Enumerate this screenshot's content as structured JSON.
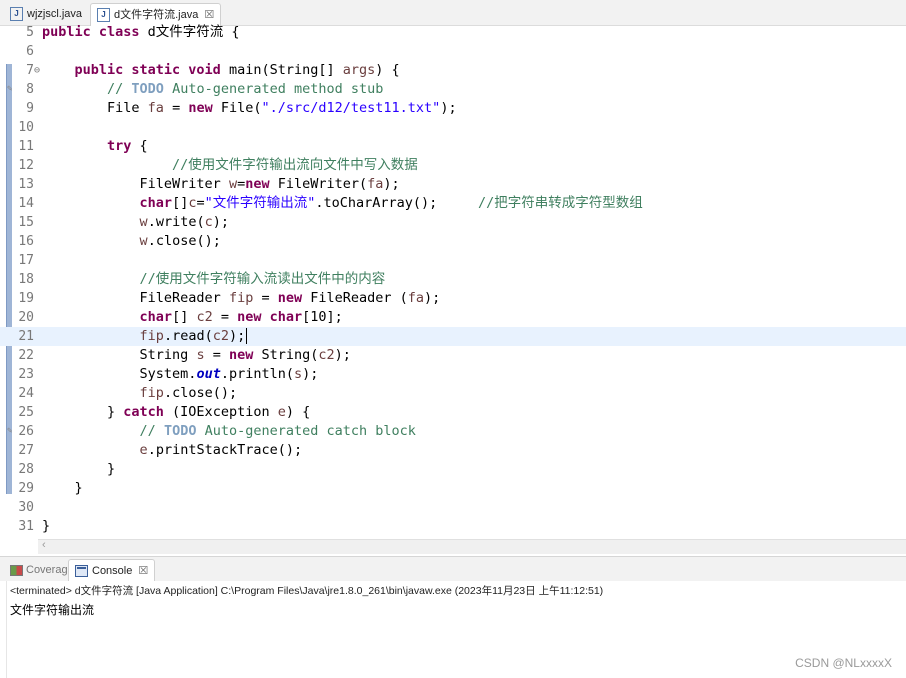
{
  "editor_tabs": [
    {
      "label": "wjzjscl.java",
      "icon": "java-file-icon",
      "active": false
    },
    {
      "label": "d文件字符流.java",
      "icon": "java-file-icon",
      "active": true,
      "close": "☒"
    }
  ],
  "code_lines": [
    {
      "num": "5",
      "html": "<span class=\"kw\">public class</span> d文件字符流 {",
      "clip": true
    },
    {
      "num": "6",
      "html": ""
    },
    {
      "num": "7",
      "fold": "⊖",
      "html": "    <span class=\"kw\">public static void</span> main(String[] <span class=\"var\">args</span>) {"
    },
    {
      "num": "8",
      "mark": "✎",
      "html": "        <span class=\"cm\">// </span><span class=\"todo\">TODO</span><span class=\"cm\"> Auto-generated method stub</span>"
    },
    {
      "num": "9",
      "html": "        File <span class=\"var\">fa</span> = <span class=\"kw\">new</span> File(<span class=\"str\">\"./src/d12/test11.txt\"</span>);"
    },
    {
      "num": "10",
      "html": ""
    },
    {
      "num": "11",
      "html": "        <span class=\"kw\">try</span> {"
    },
    {
      "num": "12",
      "html": "                <span class=\"cm\">//使用文件字符输出流向文件中写入数据</span>"
    },
    {
      "num": "13",
      "html": "            FileWriter <span class=\"var\">w</span>=<span class=\"kw\">new</span> FileWriter(<span class=\"var\">fa</span>);"
    },
    {
      "num": "14",
      "html": "            <span class=\"kw\">char</span>[]<span class=\"var\">c</span>=<span class=\"str\">\"文件字符输出流\"</span>.toCharArray();     <span class=\"cm\">//把字符串转成字符型数组</span>"
    },
    {
      "num": "15",
      "html": "            <span class=\"var\">w</span>.write(<span class=\"var\">c</span>);"
    },
    {
      "num": "16",
      "html": "            <span class=\"var\">w</span>.close();"
    },
    {
      "num": "17",
      "html": ""
    },
    {
      "num": "18",
      "html": "            <span class=\"cm\">//使用文件字符输入流读出文件中的内容</span>"
    },
    {
      "num": "19",
      "html": "            FileReader <span class=\"var\">fip</span> = <span class=\"kw\">new</span> FileReader (<span class=\"var\">fa</span>);"
    },
    {
      "num": "20",
      "html": "            <span class=\"kw\">char</span>[] <span class=\"var\">c2</span> = <span class=\"kw\">new char</span>[10];"
    },
    {
      "num": "21",
      "current": true,
      "html": "            <span class=\"var\">fip</span>.read(<span class=\"var\">c2</span>);<span class=\"caret\"></span>"
    },
    {
      "num": "22",
      "html": "            String <span class=\"var\">s</span> = <span class=\"kw\">new</span> String(<span class=\"var\">c2</span>);"
    },
    {
      "num": "23",
      "html": "            System.<span class=\"field\">out</span>.println(<span class=\"var\">s</span>);"
    },
    {
      "num": "24",
      "html": "            <span class=\"var\">fip</span>.close();"
    },
    {
      "num": "25",
      "html": "        } <span class=\"kw\">catch</span> (IOException <span class=\"var\">e</span>) {"
    },
    {
      "num": "26",
      "mark": "✎",
      "html": "            <span class=\"cm\">// </span><span class=\"todo\">TODO</span><span class=\"cm\"> Auto-generated catch block</span>"
    },
    {
      "num": "27",
      "html": "            <span class=\"var\">e</span>.printStackTrace();"
    },
    {
      "num": "28",
      "html": "        }"
    },
    {
      "num": "29",
      "html": "    }"
    },
    {
      "num": "30",
      "html": ""
    },
    {
      "num": "31",
      "html": "}"
    }
  ],
  "hscroll_arrow": "‹",
  "panel_tabs": [
    {
      "label": "Coverage",
      "active": false
    },
    {
      "label": "Console",
      "active": true,
      "close": "☒"
    }
  ],
  "console": {
    "terminated": "<terminated> d文件字符流 [Java Application] C:\\Program Files\\Java\\jre1.8.0_261\\bin\\javaw.exe (2023年11月23日 上午11:12:51)",
    "output": "文件字符输出流"
  },
  "watermark": "CSDN @NLxxxxX"
}
